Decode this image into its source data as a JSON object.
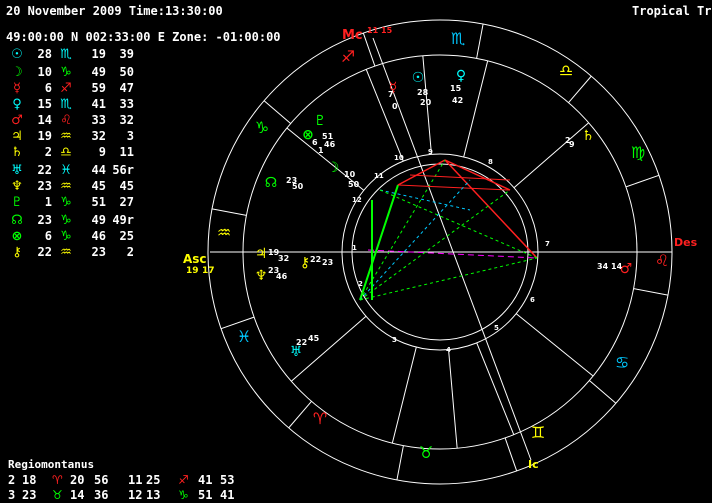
{
  "header": {
    "datetime": "20 November 2009 Time:13:30:00",
    "location": "49:00:00 N 002:33:00 E Zone: -01:00:00",
    "mode": "Tropical True"
  },
  "colors": {
    "fire": "#ff2020",
    "earth": "#00e000",
    "air": "#ffff00",
    "water": "#00c8ff",
    "white": "#ffffff",
    "magenta": "#ff00ff"
  },
  "planets": [
    {
      "glyph": "☉",
      "color": "#00ffff",
      "deg": "28",
      "sign": "♏",
      "sign_color": "#00ffff",
      "min": "19",
      "sec": "39"
    },
    {
      "glyph": "☽",
      "color": "#00ff00",
      "deg": "10",
      "sign": "♑",
      "sign_color": "#00ff00",
      "min": "49",
      "sec": "50"
    },
    {
      "glyph": "☿",
      "color": "#ff2020",
      "deg": "6",
      "sign": "♐",
      "sign_color": "#ff2020",
      "min": "59",
      "sec": "47"
    },
    {
      "glyph": "♀",
      "color": "#00ffff",
      "deg": "15",
      "sign": "♏",
      "sign_color": "#00ffff",
      "min": "41",
      "sec": "33"
    },
    {
      "glyph": "♂",
      "color": "#ff2020",
      "deg": "14",
      "sign": "♌",
      "sign_color": "#ff2020",
      "min": "33",
      "sec": "32"
    },
    {
      "glyph": "♃",
      "color": "#ffff00",
      "deg": "19",
      "sign": "♒",
      "sign_color": "#ffff00",
      "min": "32",
      "sec": "3"
    },
    {
      "glyph": "♄",
      "color": "#ffff00",
      "deg": "2",
      "sign": "♎",
      "sign_color": "#ffff00",
      "min": "9",
      "sec": "11"
    },
    {
      "glyph": "♅",
      "color": "#00ffff",
      "deg": "22",
      "sign": "♓",
      "sign_color": "#00ffff",
      "min": "44",
      "sec": "56r"
    },
    {
      "glyph": "♆",
      "color": "#ffff00",
      "deg": "23",
      "sign": "♒",
      "sign_color": "#ffff00",
      "min": "45",
      "sec": "45"
    },
    {
      "glyph": "♇",
      "color": "#00ff00",
      "deg": "1",
      "sign": "♑",
      "sign_color": "#00ff00",
      "min": "51",
      "sec": "27"
    },
    {
      "glyph": "☊",
      "color": "#00ff00",
      "deg": "23",
      "sign": "♑",
      "sign_color": "#00ff00",
      "min": "49",
      "sec": "49r"
    },
    {
      "glyph": "⊗",
      "color": "#00ff00",
      "deg": "6",
      "sign": "♑",
      "sign_color": "#00ff00",
      "min": "46",
      "sec": "25"
    },
    {
      "glyph": "⚷",
      "color": "#ffff00",
      "deg": "22",
      "sign": "♒",
      "sign_color": "#ffff00",
      "min": "23",
      "sec": "2"
    }
  ],
  "houses_title": "Regiomontanus",
  "houses": [
    {
      "house": "2",
      "deg": "18",
      "sign": "♈",
      "sign_color": "#ff2020",
      "min": "20"
    },
    {
      "house": "56",
      "deg": "11",
      "sign": "",
      "sign_color": "#ffffff",
      "min": "25"
    },
    {
      "house": "",
      "deg": "",
      "sign": "♐",
      "sign_color": "#ff2020",
      "min": "41 53"
    },
    {
      "house": "3",
      "deg": "23",
      "sign": "♉",
      "sign_color": "#00ff00",
      "min": "14 36"
    },
    {
      "house": "12",
      "deg": "13",
      "sign": "♑",
      "sign_color": "#00ff00",
      "min": "51 41"
    }
  ],
  "house_rows": [
    [
      "2",
      "18",
      "♈",
      "20",
      "56",
      "11",
      "25",
      "♐",
      "41",
      "53"
    ],
    [
      "3",
      "23",
      "♉",
      "14",
      "36",
      "12",
      "13",
      "♑",
      "51",
      "41"
    ]
  ],
  "angles": {
    "mc": "Mc",
    "mc_deg": "11",
    "mc_min": "15",
    "asc": "Asc",
    "asc_deg": "19",
    "asc_min": "17",
    "des": "Des",
    "ic": "Ic"
  },
  "wheel_planets": [
    {
      "glyph": "☉",
      "color": "#00ffff",
      "label": "28",
      "sub": "20"
    },
    {
      "glyph": "♀",
      "color": "#00ffff",
      "label": "15",
      "sub": "42"
    },
    {
      "glyph": "☿",
      "color": "#ff2020",
      "label": "7",
      "sub": "0"
    },
    {
      "glyph": "♇",
      "color": "#00ff00",
      "label": "51",
      "sub": "46"
    },
    {
      "glyph": "⊗",
      "color": "#00ff00",
      "label": "6",
      "sub": "1"
    },
    {
      "glyph": "☽",
      "color": "#00ff00",
      "label": "10",
      "sub": "50"
    },
    {
      "glyph": "☊",
      "color": "#00ff00",
      "label": "23",
      "sub": "50"
    },
    {
      "glyph": "♃",
      "color": "#ffff00",
      "label": "19",
      "sub": "32"
    },
    {
      "glyph": "♆",
      "color": "#ffff00",
      "label": "23",
      "sub": "46"
    },
    {
      "glyph": "⚷",
      "color": "#ffff00",
      "label": "22",
      "sub": "23"
    },
    {
      "glyph": "♅",
      "color": "#00ffff",
      "label": "22",
      "sub": "45"
    },
    {
      "glyph": "♄",
      "color": "#ffff00",
      "label": "2",
      "sub": "9"
    },
    {
      "glyph": "♂",
      "color": "#ff2020",
      "label": "34",
      "sub": "14"
    }
  ]
}
